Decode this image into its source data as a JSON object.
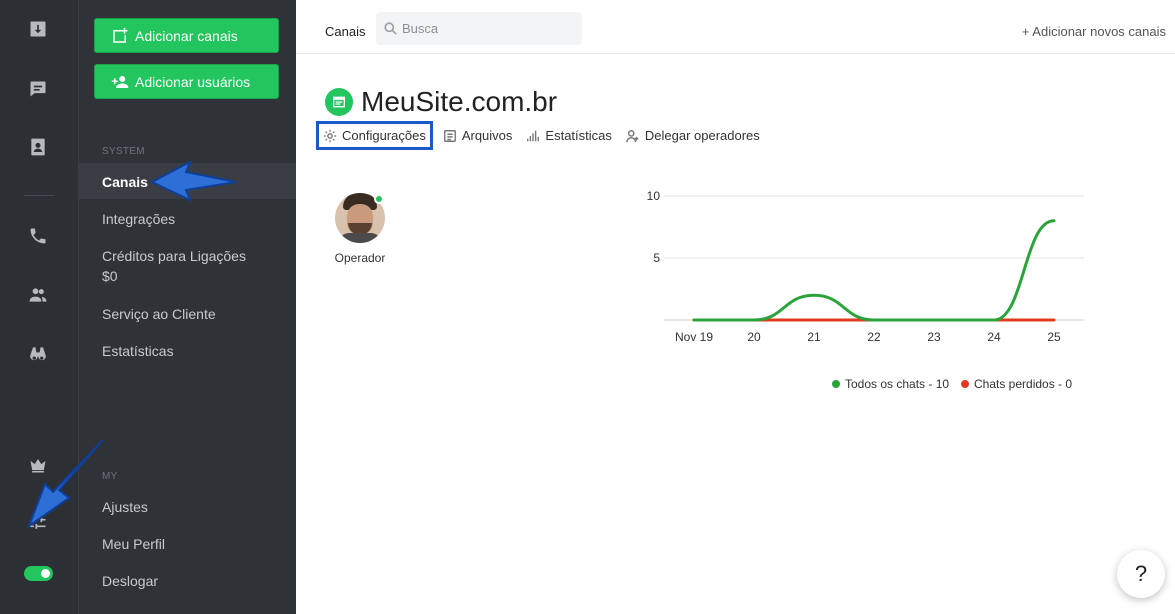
{
  "sidebar": {
    "add_channels_label": "Adicionar canais",
    "add_users_label": "Adicionar usuários",
    "section_system": "SYSTEM",
    "section_my": "MY",
    "items": [
      {
        "label": "Canais"
      },
      {
        "label": "Integrações"
      },
      {
        "label": "Créditos para Ligações",
        "sub": "$0"
      },
      {
        "label": "Serviço ao Cliente"
      },
      {
        "label": "Estatísticas"
      }
    ],
    "my_items": [
      {
        "label": "Ajustes"
      },
      {
        "label": "Meu Perfil"
      },
      {
        "label": "Deslogar"
      }
    ]
  },
  "rail": {
    "icons": [
      "download-icon",
      "chat-icon",
      "contact-card-icon",
      "phone-icon",
      "users-icon",
      "binoculars-icon",
      "crown-icon",
      "sliders-icon"
    ],
    "toggle_on": true
  },
  "topbar": {
    "title": "Canais",
    "search_placeholder": "Busca",
    "add_new_channels": "+ Adicionar novos canais"
  },
  "site": {
    "title": "MeuSite.com.br"
  },
  "tabs": [
    {
      "label": "Configurações",
      "icon": "gear-icon",
      "active": true
    },
    {
      "label": "Arquivos",
      "icon": "document-icon"
    },
    {
      "label": "Estatísticas",
      "icon": "signal-icon"
    },
    {
      "label": "Delegar operadores",
      "icon": "user-plus-icon"
    }
  ],
  "operator": {
    "label": "Operador",
    "online": true
  },
  "help": {
    "label": "?"
  },
  "colors": {
    "accent_green": "#22c55e",
    "lost_red": "#e03a1f",
    "highlight_blue": "#1c58c8"
  },
  "chart_data": {
    "type": "line",
    "x": [
      "Nov 19",
      "20",
      "21",
      "22",
      "23",
      "24",
      "25"
    ],
    "ylim": [
      0,
      10
    ],
    "yticks": [
      5,
      10
    ],
    "grid": true,
    "legend_position": "bottom-right",
    "series": [
      {
        "name": "Todos os chats - 10",
        "color": "#2aa33a",
        "values": [
          0,
          0,
          2,
          0,
          0,
          0,
          8
        ]
      },
      {
        "name": "Chats perdidos - 0",
        "color": "#e03a1f",
        "values": [
          0,
          0,
          0,
          0,
          0,
          0,
          0
        ]
      }
    ]
  }
}
